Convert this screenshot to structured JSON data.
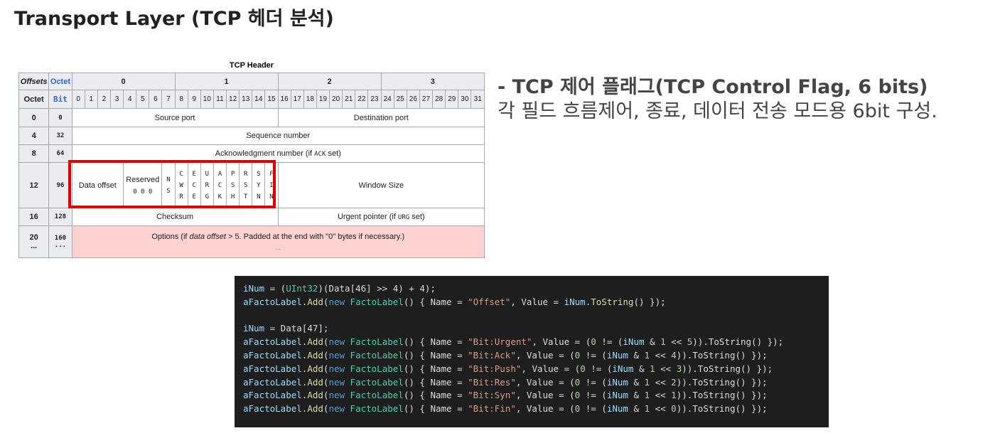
{
  "slide": {
    "title": "Transport Layer (TCP 헤더 분석)",
    "flag_title": "- TCP 제어 플래그(TCP Control Flag, 6 bits)",
    "flag_desc": "각 필드 흐름제어, 종료, 데이터 전송 모드용 6bit 구성."
  },
  "tcp_header": {
    "caption": "TCP Header",
    "offsets_label": "Offsets",
    "octet_label": "Octet",
    "bit_label": "Bit",
    "octets": [
      "0",
      "1",
      "2",
      "3"
    ],
    "bits": [
      "0",
      "1",
      "2",
      "3",
      "4",
      "5",
      "6",
      "7",
      "8",
      "9",
      "10",
      "11",
      "12",
      "13",
      "14",
      "15",
      "16",
      "17",
      "18",
      "19",
      "20",
      "21",
      "22",
      "23",
      "24",
      "25",
      "26",
      "27",
      "28",
      "29",
      "30",
      "31"
    ],
    "rows": [
      {
        "octet": "0",
        "bit": "0"
      },
      {
        "octet": "4",
        "bit": "32"
      },
      {
        "octet": "8",
        "bit": "64"
      },
      {
        "octet": "12",
        "bit": "96"
      },
      {
        "octet": "16",
        "bit": "128"
      },
      {
        "octet": "20",
        "octet2": "...",
        "bit": "160",
        "bit2": "..."
      }
    ],
    "source_port": "Source port",
    "destination_port": "Destination port",
    "sequence_number": "Sequence number",
    "ack_prefix": "Acknowledgment number (if ",
    "ack_code": "ACK",
    "ack_suffix": " set)",
    "data_offset": "Data offset",
    "reserved": "Reserved",
    "reserved_bits": "0 0 0",
    "ns_flag": [
      "N",
      "S"
    ],
    "flags": [
      [
        "C",
        "W",
        "R"
      ],
      [
        "E",
        "C",
        "E"
      ],
      [
        "U",
        "R",
        "G"
      ],
      [
        "A",
        "C",
        "K"
      ],
      [
        "P",
        "S",
        "H"
      ],
      [
        "R",
        "S",
        "T"
      ],
      [
        "S",
        "Y",
        "N"
      ],
      [
        "F",
        "I",
        "N"
      ]
    ],
    "window_size": "Window Size",
    "checksum": "Checksum",
    "urgent_prefix": "Urgent pointer (if ",
    "urgent_code": "URG",
    "urgent_suffix": " set)",
    "options_prefix": "Options (if ",
    "options_italic": "data offset",
    "options_suffix": " > 5. Padded at the end with \"0\" bytes if necessary.)",
    "options_line2": "..."
  },
  "code_lines": [
    [
      [
        "v",
        "iNum"
      ],
      [
        "pl",
        " = ("
      ],
      [
        "ty",
        "UInt32"
      ],
      [
        "pl",
        ")(Data[46] >> 4) + 4);"
      ]
    ],
    [
      [
        "v",
        "aFactoLabel"
      ],
      [
        "pl",
        "."
      ],
      [
        "fn",
        "Add"
      ],
      [
        "pl",
        "("
      ],
      [
        "kw",
        "new"
      ],
      [
        "pl",
        " "
      ],
      [
        "ty",
        "FactoLabel"
      ],
      [
        "pl",
        "() { Name = "
      ],
      [
        "str",
        "\"Offset\""
      ],
      [
        "pl",
        ", Value = "
      ],
      [
        "v",
        "iNum"
      ],
      [
        "pl",
        "."
      ],
      [
        "fn",
        "ToString"
      ],
      [
        "pl",
        "() });"
      ]
    ],
    [],
    [
      [
        "v",
        "iNum"
      ],
      [
        "pl",
        " = Data[47];"
      ]
    ],
    [
      [
        "v",
        "aFactoLabel"
      ],
      [
        "pl",
        "."
      ],
      [
        "fn",
        "Add"
      ],
      [
        "pl",
        "("
      ],
      [
        "kw",
        "new"
      ],
      [
        "pl",
        " "
      ],
      [
        "ty",
        "FactoLabel"
      ],
      [
        "pl",
        "() { Name = "
      ],
      [
        "str",
        "\"Bit:Urgent\""
      ],
      [
        "pl",
        ", Value = ("
      ],
      [
        "num",
        "0"
      ],
      [
        "pl",
        " != ("
      ],
      [
        "v",
        "iNum"
      ],
      [
        "pl",
        " & "
      ],
      [
        "num",
        "1"
      ],
      [
        "pl",
        " << "
      ],
      [
        "num",
        "5"
      ],
      [
        "pl",
        ")).ToString() });"
      ]
    ],
    [
      [
        "v",
        "aFactoLabel"
      ],
      [
        "pl",
        "."
      ],
      [
        "fn",
        "Add"
      ],
      [
        "pl",
        "("
      ],
      [
        "kw",
        "new"
      ],
      [
        "pl",
        " "
      ],
      [
        "ty",
        "FactoLabel"
      ],
      [
        "pl",
        "() { Name = "
      ],
      [
        "str",
        "\"Bit:Ack\""
      ],
      [
        "pl",
        ", Value = ("
      ],
      [
        "num",
        "0"
      ],
      [
        "pl",
        " != ("
      ],
      [
        "v",
        "iNum"
      ],
      [
        "pl",
        " & "
      ],
      [
        "num",
        "1"
      ],
      [
        "pl",
        " << "
      ],
      [
        "num",
        "4"
      ],
      [
        "pl",
        ")).ToString() });"
      ]
    ],
    [
      [
        "v",
        "aFactoLabel"
      ],
      [
        "pl",
        "."
      ],
      [
        "fn",
        "Add"
      ],
      [
        "pl",
        "("
      ],
      [
        "kw",
        "new"
      ],
      [
        "pl",
        " "
      ],
      [
        "ty",
        "FactoLabel"
      ],
      [
        "pl",
        "() { Name = "
      ],
      [
        "str",
        "\"Bit:Push\""
      ],
      [
        "pl",
        ", Value = ("
      ],
      [
        "num",
        "0"
      ],
      [
        "pl",
        " != ("
      ],
      [
        "v",
        "iNum"
      ],
      [
        "pl",
        " & "
      ],
      [
        "num",
        "1"
      ],
      [
        "pl",
        " << "
      ],
      [
        "num",
        "3"
      ],
      [
        "pl",
        ")).ToString() });"
      ]
    ],
    [
      [
        "v",
        "aFactoLabel"
      ],
      [
        "pl",
        "."
      ],
      [
        "fn",
        "Add"
      ],
      [
        "pl",
        "("
      ],
      [
        "kw",
        "new"
      ],
      [
        "pl",
        " "
      ],
      [
        "ty",
        "FactoLabel"
      ],
      [
        "pl",
        "() { Name = "
      ],
      [
        "str",
        "\"Bit:Res\""
      ],
      [
        "pl",
        ", Value = ("
      ],
      [
        "num",
        "0"
      ],
      [
        "pl",
        " != ("
      ],
      [
        "v",
        "iNum"
      ],
      [
        "pl",
        " & "
      ],
      [
        "num",
        "1"
      ],
      [
        "pl",
        " << "
      ],
      [
        "num",
        "2"
      ],
      [
        "pl",
        ")).ToString() });"
      ]
    ],
    [
      [
        "v",
        "aFactoLabel"
      ],
      [
        "pl",
        "."
      ],
      [
        "fn",
        "Add"
      ],
      [
        "pl",
        "("
      ],
      [
        "kw",
        "new"
      ],
      [
        "pl",
        " "
      ],
      [
        "ty",
        "FactoLabel"
      ],
      [
        "pl",
        "() { Name = "
      ],
      [
        "str",
        "\"Bit:Syn\""
      ],
      [
        "pl",
        ", Value = ("
      ],
      [
        "num",
        "0"
      ],
      [
        "pl",
        " != ("
      ],
      [
        "v",
        "iNum"
      ],
      [
        "pl",
        " & "
      ],
      [
        "num",
        "1"
      ],
      [
        "pl",
        " << "
      ],
      [
        "num",
        "1"
      ],
      [
        "pl",
        ")).ToString() });"
      ]
    ],
    [
      [
        "v",
        "aFactoLabel"
      ],
      [
        "pl",
        "."
      ],
      [
        "fn",
        "Add"
      ],
      [
        "pl",
        "("
      ],
      [
        "kw",
        "new"
      ],
      [
        "pl",
        " "
      ],
      [
        "ty",
        "FactoLabel"
      ],
      [
        "pl",
        "() { Name = "
      ],
      [
        "str",
        "\"Bit:Fin\""
      ],
      [
        "pl",
        ", Value = ("
      ],
      [
        "num",
        "0"
      ],
      [
        "pl",
        " != ("
      ],
      [
        "v",
        "iNum"
      ],
      [
        "pl",
        " & "
      ],
      [
        "num",
        "1"
      ],
      [
        "pl",
        " << "
      ],
      [
        "num",
        "0"
      ],
      [
        "pl",
        ")).ToString() });"
      ]
    ]
  ]
}
